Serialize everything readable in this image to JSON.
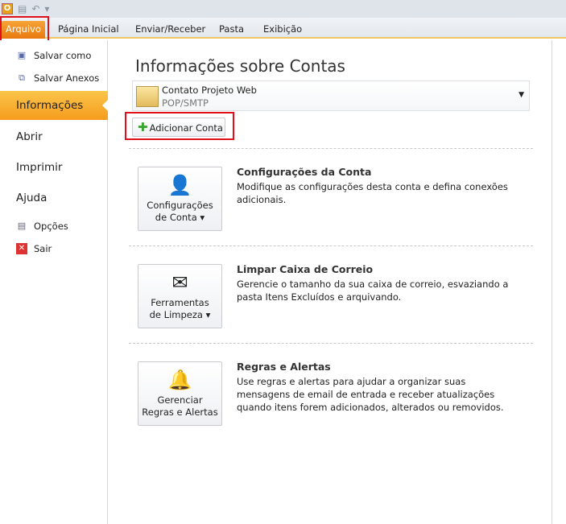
{
  "qat": {
    "logo": "O"
  },
  "tabs": [
    "Arquivo",
    "Página Inicial",
    "Enviar/Receber",
    "Pasta",
    "Exibição"
  ],
  "sidebar": {
    "items": [
      "Salvar como",
      "Salvar Anexos",
      "Informações",
      "Abrir",
      "Imprimir",
      "Ajuda",
      "Opções",
      "Sair"
    ]
  },
  "main": {
    "title": "Informações sobre Contas",
    "account": {
      "name": "Contato Projeto Web",
      "type": "POP/SMTP"
    },
    "add_account": "Adicionar Conta",
    "sections": [
      {
        "button": [
          "Configurações",
          "de Conta"
        ],
        "title": "Configurações da Conta",
        "desc": "Modifique as configurações desta conta e defina conexões adicionais."
      },
      {
        "button": [
          "Ferramentas",
          "de Limpeza"
        ],
        "title": "Limpar Caixa de Correio",
        "desc": "Gerencie o tamanho da sua caixa de correio, esvaziando a pasta Itens Excluídos e arquivando."
      },
      {
        "button": [
          "Gerenciar",
          "Regras e Alertas"
        ],
        "title": "Regras e Alertas",
        "desc": "Use regras e alertas para ajudar a organizar suas mensagens de email de entrada e receber atualizações quando itens forem adicionados, alterados ou removidos."
      }
    ]
  },
  "colors": {
    "accent": "#f59c1d",
    "highlight": "#e0101a"
  }
}
